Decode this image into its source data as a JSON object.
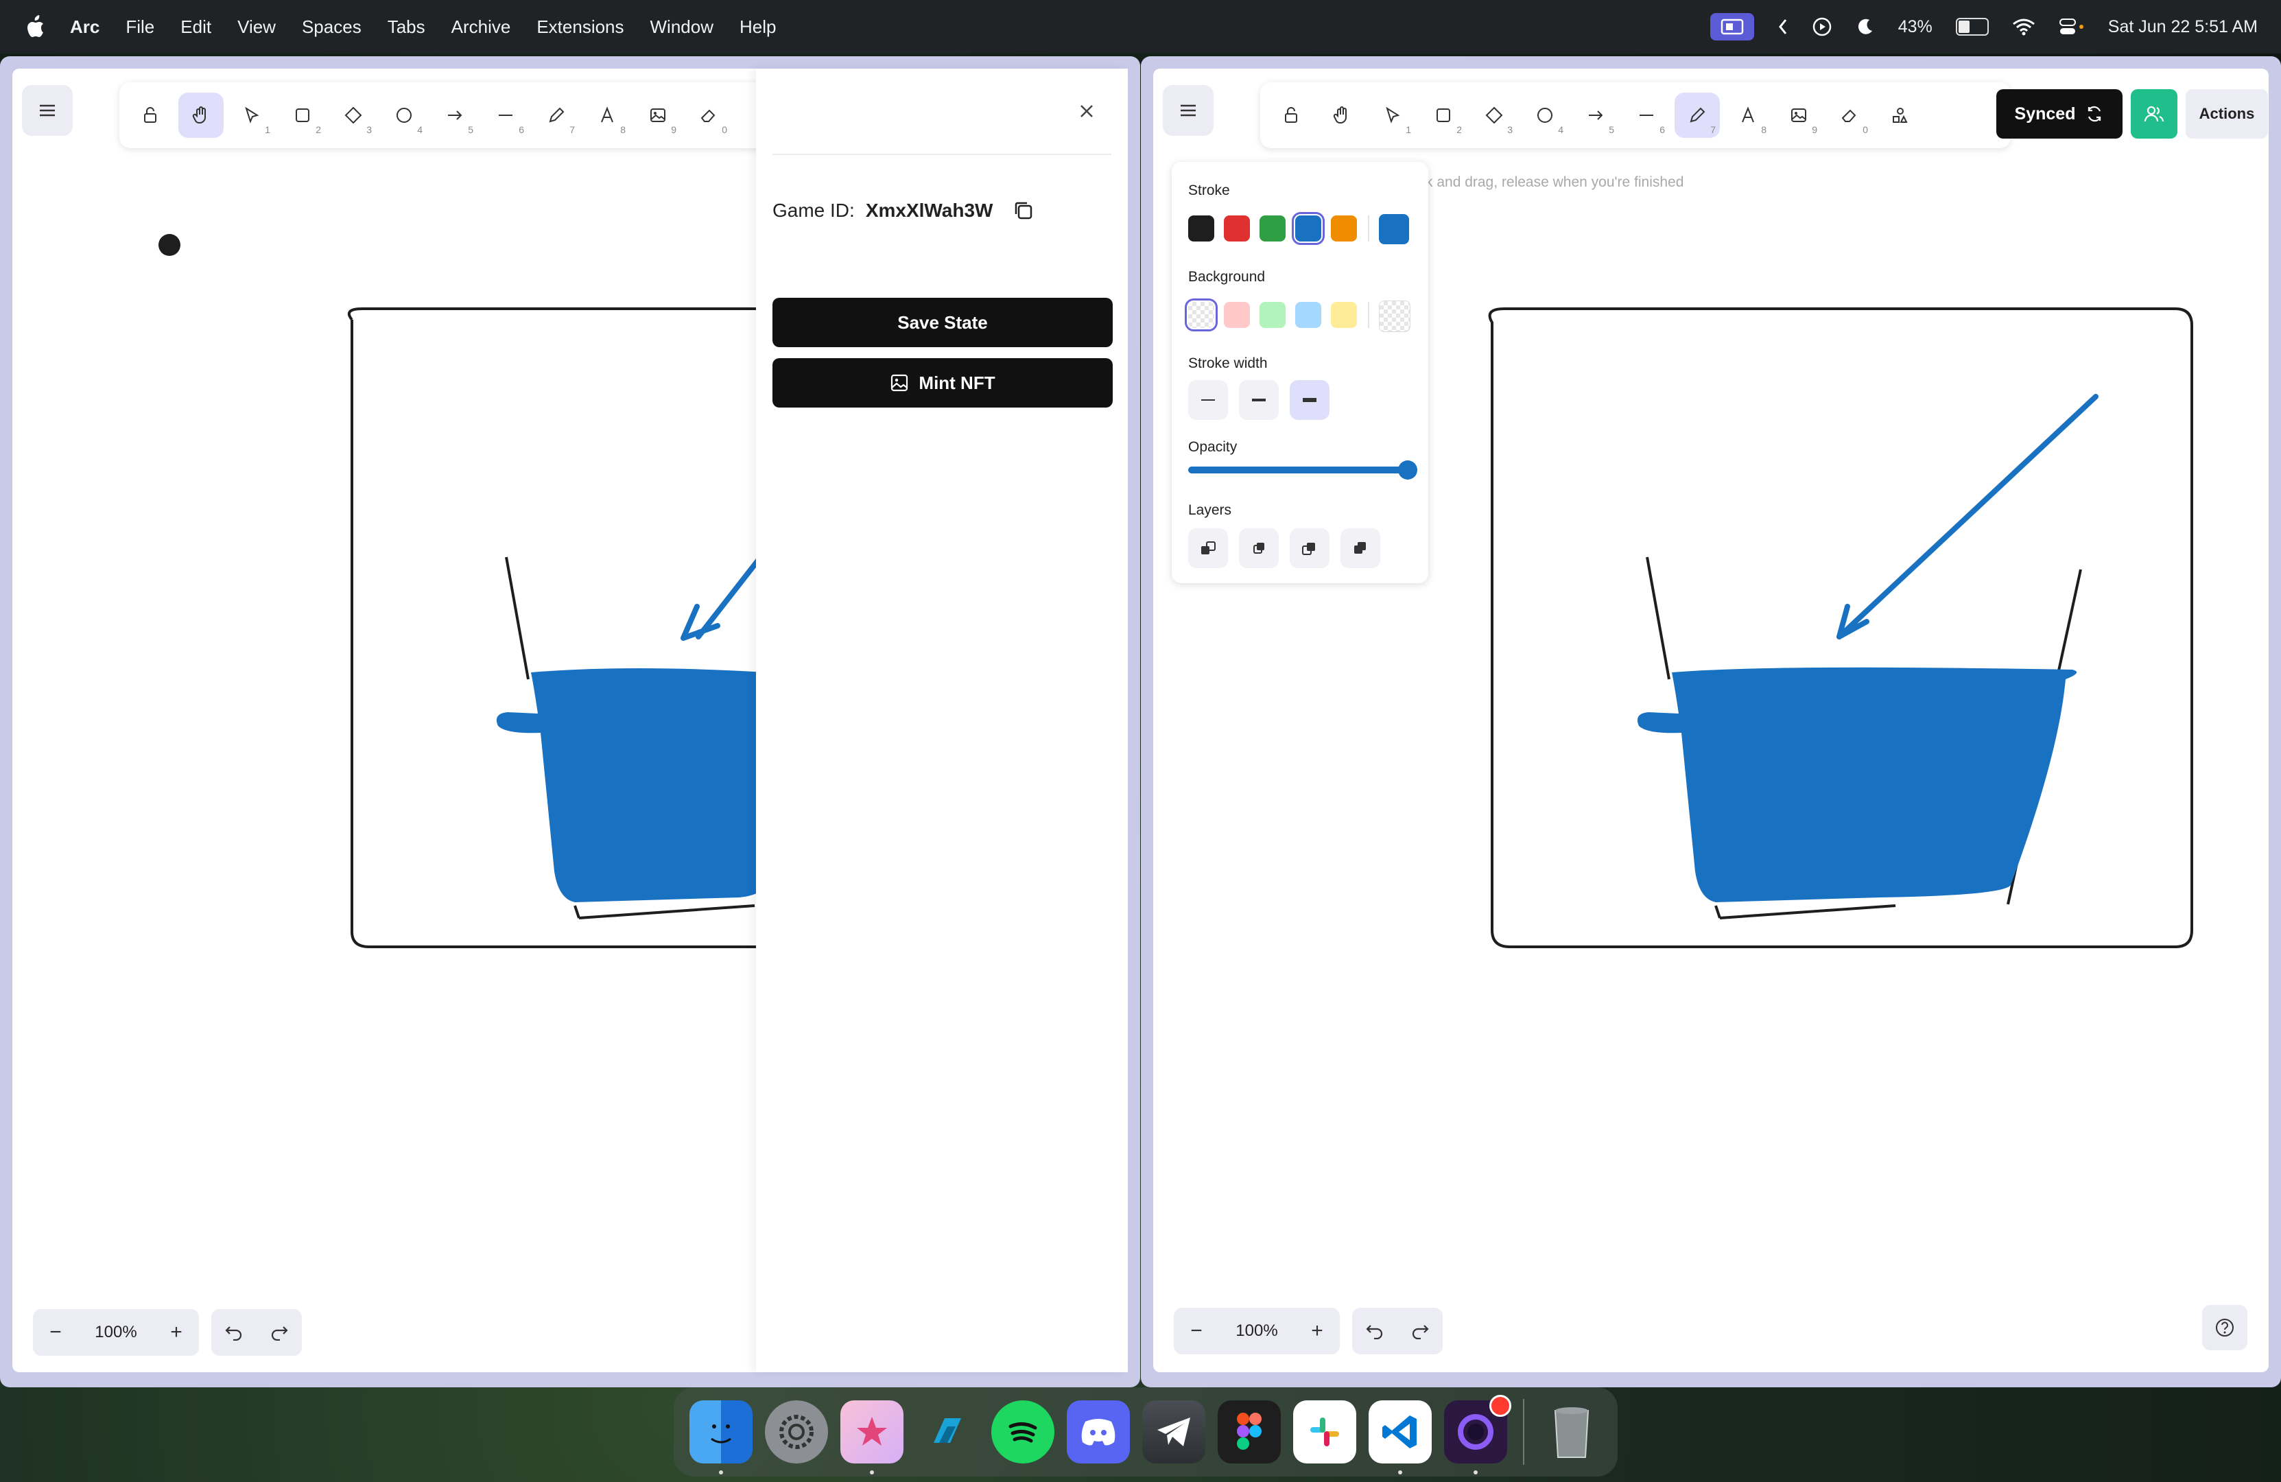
{
  "menubar": {
    "app_name": "Arc",
    "items": [
      "File",
      "Edit",
      "View",
      "Spaces",
      "Tabs",
      "Archive",
      "Extensions",
      "Window",
      "Help"
    ],
    "battery": "43%",
    "datetime": "Sat Jun 22  5:51 AM"
  },
  "toolbar": {
    "tools": [
      {
        "name": "lock",
        "key": ""
      },
      {
        "name": "hand",
        "key": ""
      },
      {
        "name": "selection",
        "key": "1"
      },
      {
        "name": "rectangle",
        "key": "2"
      },
      {
        "name": "diamond",
        "key": "3"
      },
      {
        "name": "ellipse",
        "key": "4"
      },
      {
        "name": "arrow",
        "key": "5"
      },
      {
        "name": "line",
        "key": "6"
      },
      {
        "name": "draw",
        "key": "7"
      },
      {
        "name": "text",
        "key": "8"
      },
      {
        "name": "image",
        "key": "9"
      },
      {
        "name": "eraser",
        "key": "0"
      }
    ]
  },
  "left_window": {
    "active_tool": "hand",
    "zoom": "100%",
    "panel": {
      "game_id_label": "Game ID:",
      "game_id_value": "XmxXlWah3W",
      "save_label": "Save State",
      "mint_label": "Mint NFT"
    }
  },
  "right_window": {
    "active_tool": "draw",
    "zoom": "100%",
    "hint": "Click and drag, release when you're finished",
    "synced_label": "Synced",
    "actions_label": "Actions",
    "props": {
      "stroke_label": "Stroke",
      "stroke_colors": [
        "#1e1e1e",
        "#e03131",
        "#2f9e44",
        "#1971c2",
        "#f08c00"
      ],
      "stroke_selected": "#1971c2",
      "background_label": "Background",
      "background_colors": [
        "transparent",
        "#ffc9c9",
        "#b2f2bb",
        "#a5d8ff",
        "#ffec99"
      ],
      "stroke_width_label": "Stroke width",
      "opacity_label": "Opacity",
      "opacity_value": 100,
      "layers_label": "Layers"
    }
  },
  "colors": {
    "accent": "#6965db",
    "drawing_blue": "#1971c2",
    "synced_bg": "#111111",
    "collab_green": "#1fbe8a"
  },
  "dock": [
    "Finder",
    "System Settings",
    "Mindmap app",
    "Clipboard app",
    "Spotify",
    "Discord",
    "Telegram",
    "Figma",
    "Slack",
    "Visual Studio Code",
    "Arc",
    "Trash"
  ]
}
